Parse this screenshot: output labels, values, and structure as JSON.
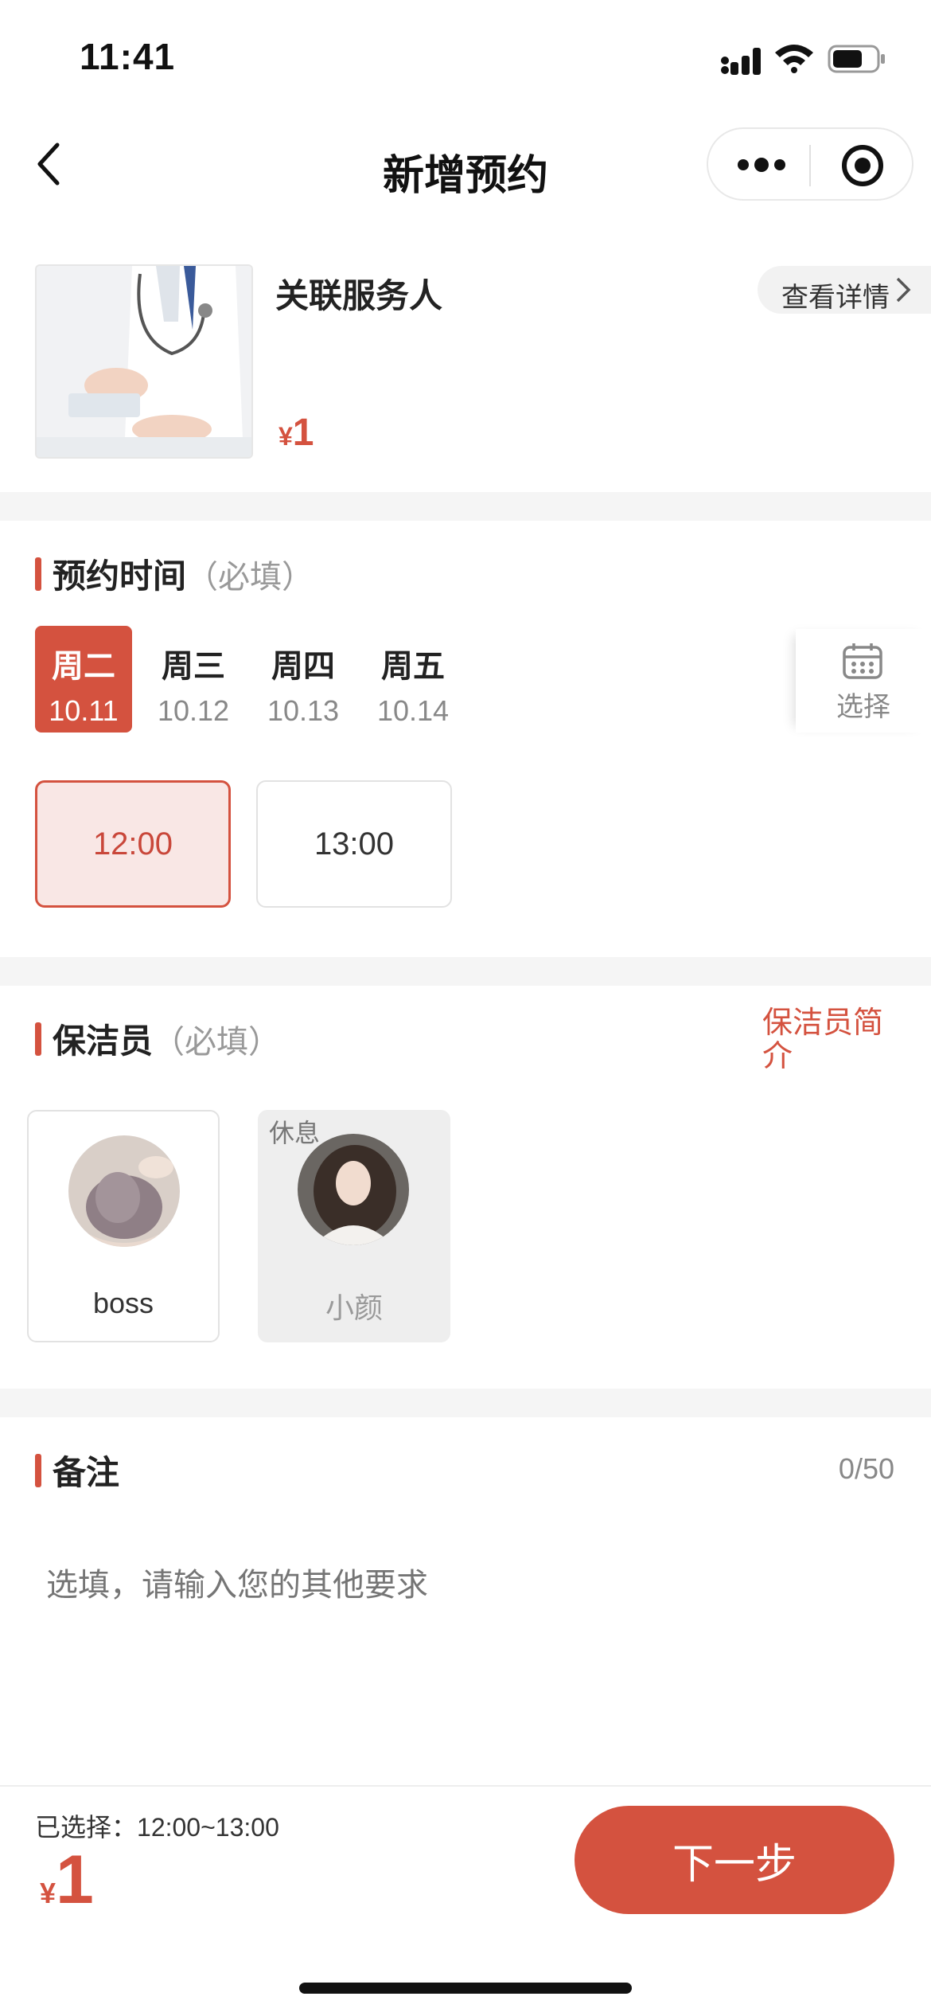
{
  "status_bar": {
    "time": "11:41"
  },
  "nav": {
    "title": "新增预约"
  },
  "service": {
    "name": "关联服务人",
    "currency": "¥",
    "price": "1",
    "detail_label": "查看详情"
  },
  "booking_time": {
    "title": "预约时间",
    "required": "（必填）",
    "dates": [
      {
        "day": "周二",
        "date": "10.11",
        "selected": true
      },
      {
        "day": "周三",
        "date": "10.12",
        "selected": false
      },
      {
        "day": "周四",
        "date": "10.13",
        "selected": false
      },
      {
        "day": "周五",
        "date": "10.14",
        "selected": false
      }
    ],
    "calendar_label": "选择",
    "slots": [
      {
        "label": "12:00",
        "selected": true
      },
      {
        "label": "13:00",
        "selected": false
      }
    ]
  },
  "cleaner": {
    "title": "保洁员",
    "required": "（必填）",
    "intro_link": "保洁员简介",
    "staff": [
      {
        "name": "boss",
        "rest": false
      },
      {
        "name": "小颜",
        "rest": true,
        "rest_label": "休息"
      }
    ]
  },
  "remark": {
    "title": "备注",
    "counter": "0/50",
    "placeholder": "选填，请输入您的其他要求"
  },
  "footer": {
    "selected_label": "已选择：",
    "selected_value": "12:00~13:00",
    "currency": "¥",
    "price": "1",
    "next_button": "下一步"
  },
  "colors": {
    "accent": "#d4523f",
    "accent_light": "#f9e7e5"
  }
}
